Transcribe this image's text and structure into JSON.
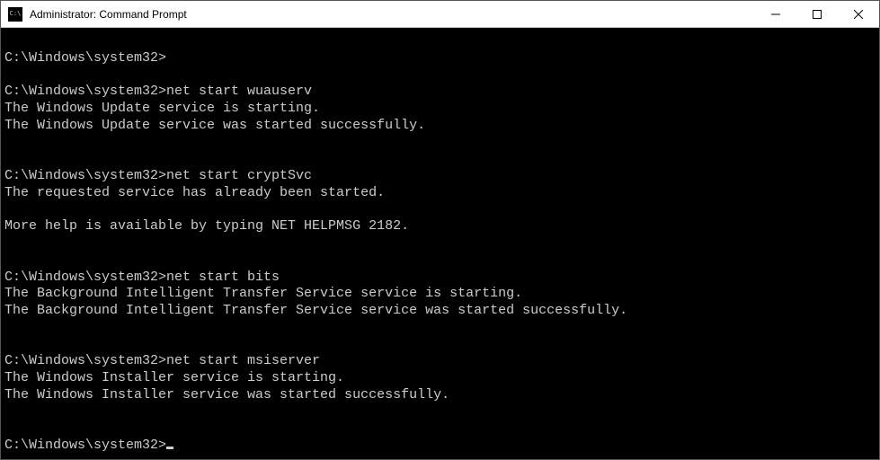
{
  "window": {
    "title": "Administrator: Command Prompt"
  },
  "terminal": {
    "lines": [
      "",
      "C:\\Windows\\system32>",
      "",
      "C:\\Windows\\system32>net start wuauserv",
      "The Windows Update service is starting.",
      "The Windows Update service was started successfully.",
      "",
      "",
      "C:\\Windows\\system32>net start cryptSvc",
      "The requested service has already been started.",
      "",
      "More help is available by typing NET HELPMSG 2182.",
      "",
      "",
      "C:\\Windows\\system32>net start bits",
      "The Background Intelligent Transfer Service service is starting.",
      "The Background Intelligent Transfer Service service was started successfully.",
      "",
      "",
      "C:\\Windows\\system32>net start msiserver",
      "The Windows Installer service is starting.",
      "The Windows Installer service was started successfully.",
      "",
      "",
      "C:\\Windows\\system32>"
    ],
    "cursor_on_last": true
  }
}
